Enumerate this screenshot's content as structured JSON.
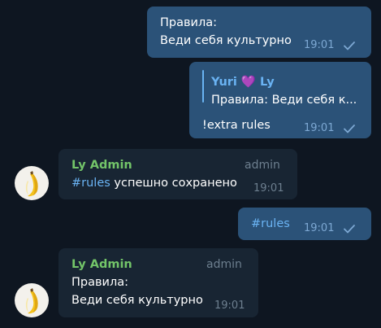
{
  "messages": [
    {
      "line1": "Правила:",
      "line2": "Веди себя культурно",
      "time": "19:01"
    },
    {
      "reply_name": "Yuri 💜 Ly",
      "reply_text": "Правила: Веди себя к...",
      "text": "!extra rules",
      "time": "19:01"
    },
    {
      "sender": "Ly Admin",
      "role": "admin",
      "hashtag": "#rules",
      "text_rest": " успешно сохранено",
      "time": "19:01"
    },
    {
      "hashtag": "#rules",
      "time": "19:01"
    },
    {
      "sender": "Ly Admin",
      "role": "admin",
      "line1": "Правила:",
      "line2": "Веди себя культурно",
      "time": "19:01"
    }
  ],
  "colors": {
    "background": "#0e1621",
    "outgoing_bubble": "#2b5278",
    "incoming_bubble": "#182533",
    "sender_name": "#73c569",
    "link": "#6ab3f3"
  },
  "icons": [
    "read-check-icon",
    "banana-avatar-icon"
  ]
}
